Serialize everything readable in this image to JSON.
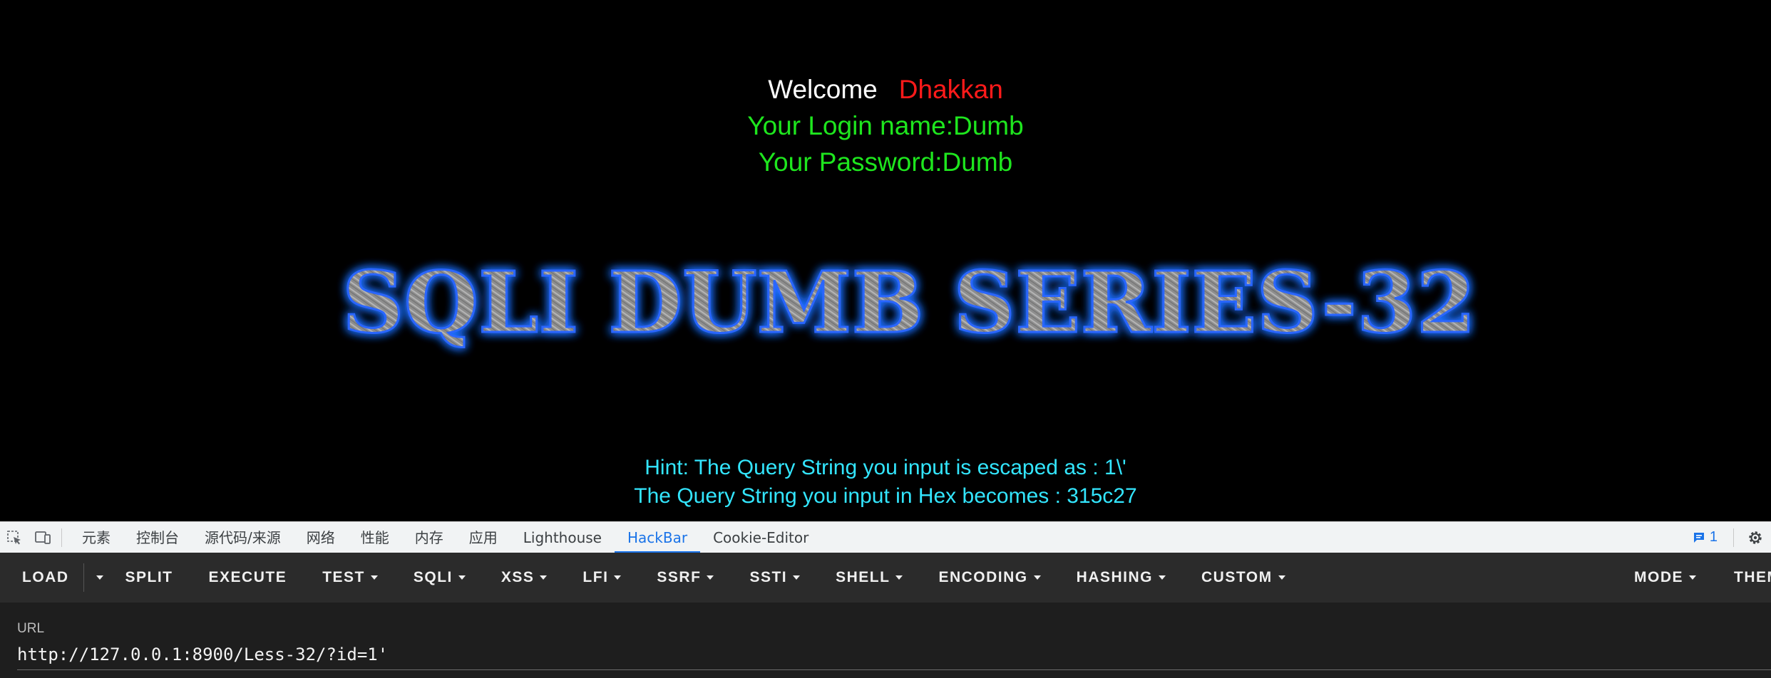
{
  "page": {
    "welcome_label": "Welcome",
    "user_name": "Dhakkan",
    "login_line": "Your Login name:Dumb",
    "password_line": "Your Password:Dumb",
    "banner_text": "SQLI DUMB SERIES-32",
    "hint_line1": "Hint: The Query String you input is escaped as : 1\\'",
    "hint_line2": "The Query String you input in Hex becomes : 315c27",
    "colors": {
      "welcome": "#ffffff",
      "name": "#ff1a1a",
      "credentials": "#1ee61e",
      "hint": "#33e6ff",
      "banner_glow": "#1f6fff"
    }
  },
  "devtools": {
    "icons": [
      "inspect-element-icon",
      "device-toolbar-icon"
    ],
    "tabs": [
      {
        "label": "元素"
      },
      {
        "label": "控制台"
      },
      {
        "label": "源代码/来源"
      },
      {
        "label": "网络"
      },
      {
        "label": "性能"
      },
      {
        "label": "内存"
      },
      {
        "label": "应用"
      },
      {
        "label": "Lighthouse"
      },
      {
        "label": "HackBar",
        "active": true
      },
      {
        "label": "Cookie-Editor"
      }
    ],
    "issues_count": "1"
  },
  "hackbar": {
    "buttons": {
      "load": "LOAD",
      "split": "SPLIT",
      "execute": "EXECUTE",
      "test": "TEST",
      "sqli": "SQLI",
      "xss": "XSS",
      "lfi": "LFI",
      "ssrf": "SSRF",
      "ssti": "SSTI",
      "shell": "SHELL",
      "encoding": "ENCODING",
      "hashing": "HASHING",
      "custom": "CUSTOM",
      "mode": "MODE",
      "theme": "THEM"
    },
    "url_label": "URL",
    "url_value": "http://127.0.0.1:8900/Less-32/?id=1'"
  }
}
